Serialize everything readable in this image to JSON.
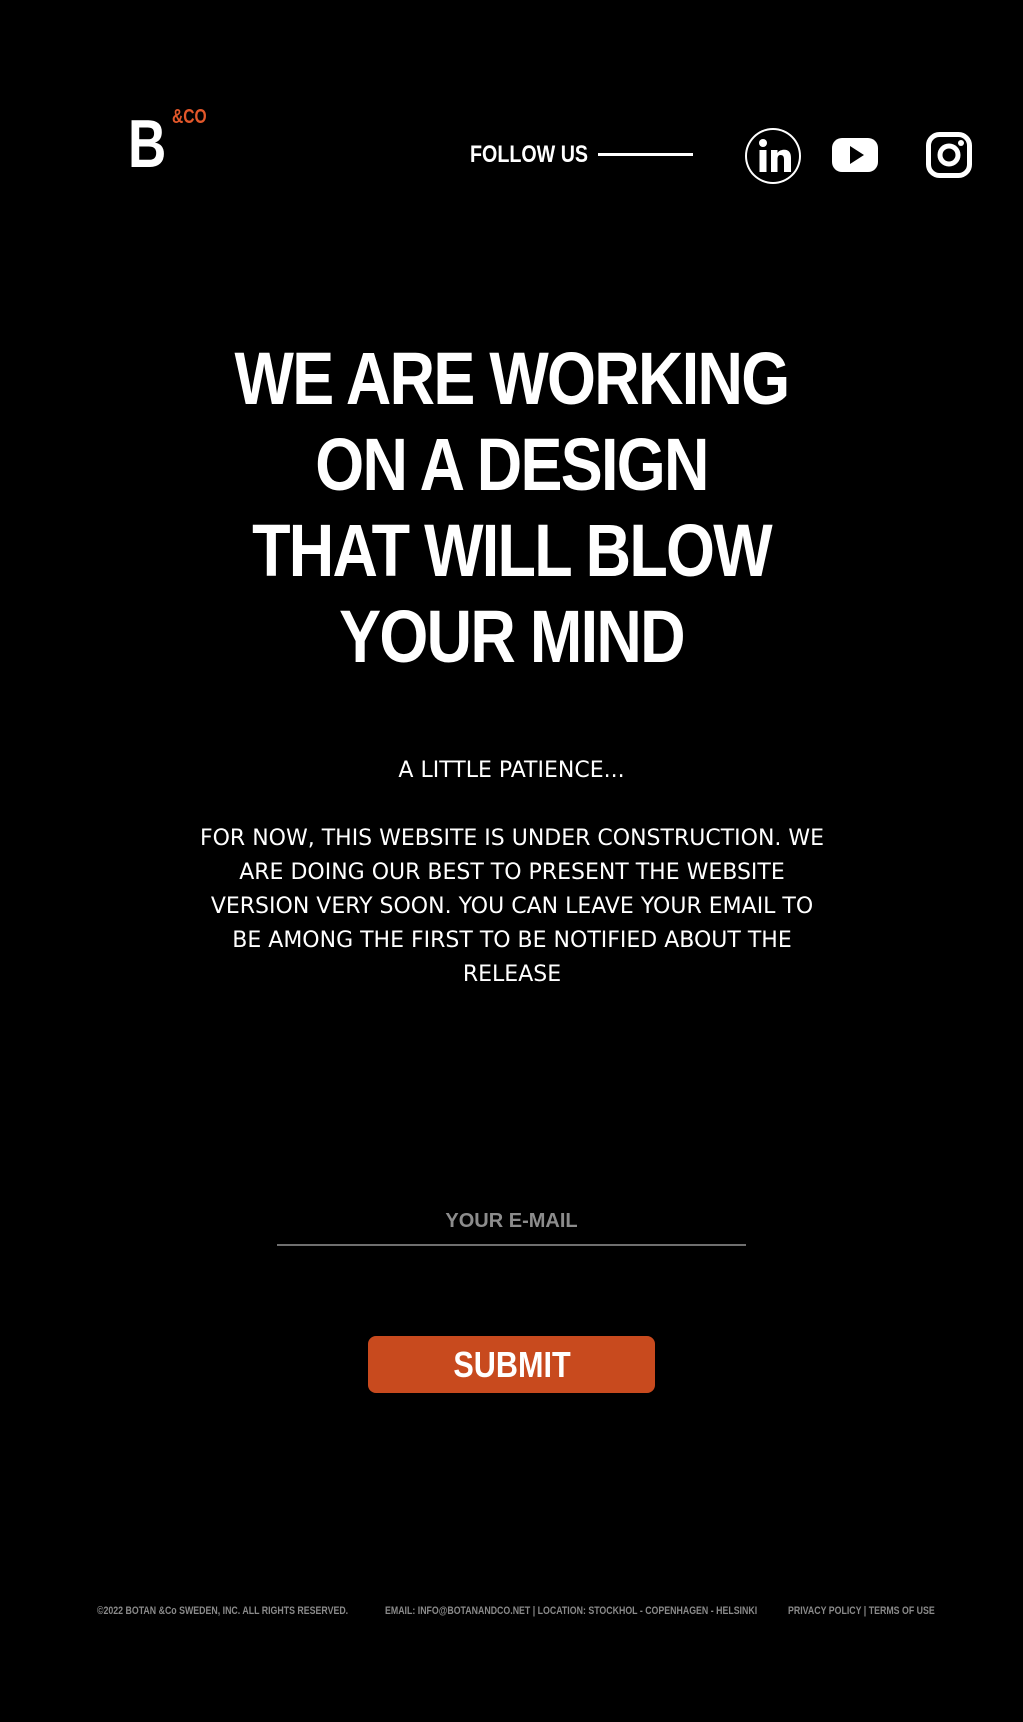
{
  "brand": {
    "letter": "B",
    "suffix": "&CO",
    "accent_color": "#e2572a"
  },
  "header": {
    "follow_label": "FOLLOW US",
    "social": [
      {
        "name": "linkedin-icon"
      },
      {
        "name": "youtube-icon"
      },
      {
        "name": "instagram-icon"
      }
    ]
  },
  "hero": {
    "headline_lines": [
      "WE ARE WORKING",
      "ON A DESIGN",
      "THAT WILL BLOW",
      "YOUR MIND"
    ],
    "patience": "A LITTLE PATIENCE...",
    "body": "FOR NOW, THIS WEBSITE IS UNDER CONSTRUCTION. WE ARE DOING OUR BEST TO PRESENT THE WEBSITE VERSION VERY SOON. YOU CAN LEAVE YOUR EMAIL TO BE AMONG THE FIRST TO BE NOTIFIED ABOUT THE RELEASE"
  },
  "form": {
    "email_value": "",
    "email_placeholder": "YOUR E-MAIL",
    "submit_label": "SUBMIT",
    "button_color": "#c84a1e"
  },
  "footer": {
    "copyright": "©2022 BOTAN &Co SWEDEN, INC. ALL RIGHTS RESERVED.",
    "contact": "EMAIL:  INFO@BOTANANDCO.NET  | LOCATION:  STOCKHOL  -  COPENHAGEN  -  HELSINKI",
    "privacy_label": "PRIVACY POLICY",
    "separator": " | ",
    "terms_label": "TERMS OF USE"
  }
}
